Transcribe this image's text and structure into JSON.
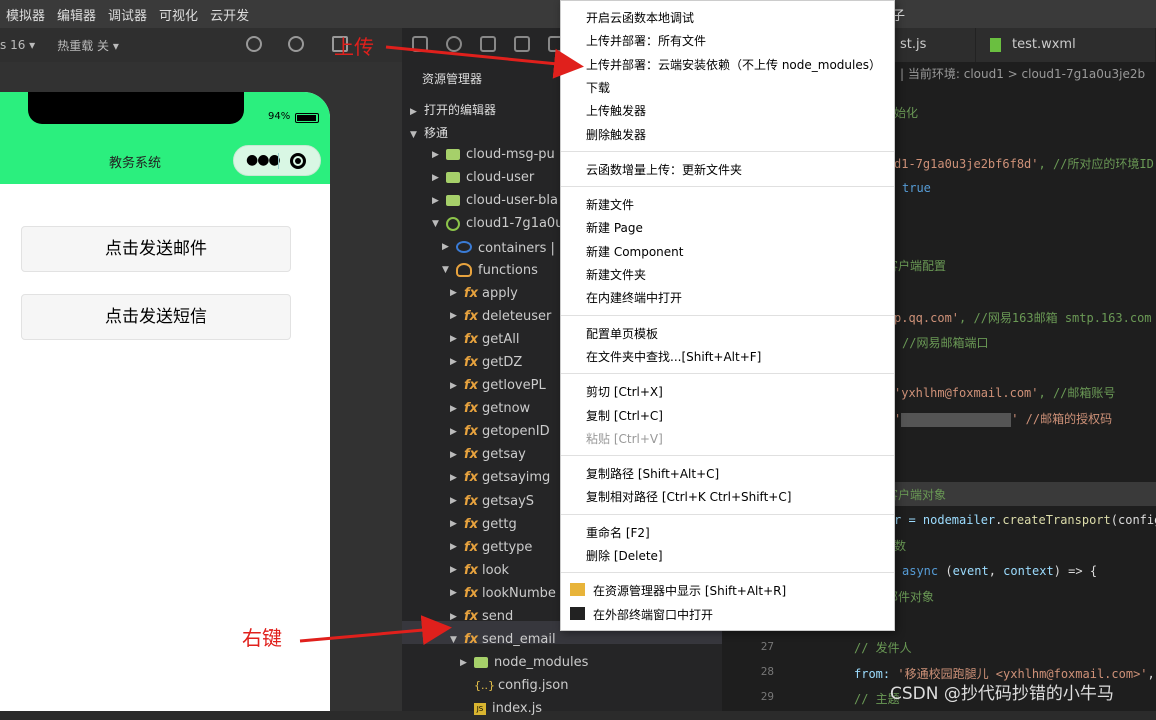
{
  "menubar": [
    "模拟器",
    "编辑器",
    "调试器",
    "可视化",
    "云开发"
  ],
  "toolbar2": {
    "zoom": "s 16 ▾",
    "hot": "热重载 关 ▾"
  },
  "phone": {
    "battery": "94%",
    "title": "教务系统",
    "buttons": [
      "点击发送邮件",
      "点击发送短信"
    ]
  },
  "explorer": {
    "title": "资源管理器",
    "sections": [
      "打开的编辑器",
      "移通"
    ],
    "items": [
      {
        "label": "cloud-msg-pu",
        "kind": "cloud"
      },
      {
        "label": "cloud-user",
        "kind": "cloud"
      },
      {
        "label": "cloud-user-bla",
        "kind": "cloud"
      },
      {
        "label": "cloud1-7g1a0u",
        "kind": "env"
      },
      {
        "label": "containers | 当",
        "kind": "cont"
      },
      {
        "label": "functions",
        "kind": "fnf"
      },
      {
        "label": "apply",
        "kind": "fx"
      },
      {
        "label": "deleteuser",
        "kind": "fx"
      },
      {
        "label": "getAll",
        "kind": "fx"
      },
      {
        "label": "getDZ",
        "kind": "fx"
      },
      {
        "label": "getlovePL",
        "kind": "fx"
      },
      {
        "label": "getnow",
        "kind": "fx"
      },
      {
        "label": "getopenID",
        "kind": "fx"
      },
      {
        "label": "getsay",
        "kind": "fx"
      },
      {
        "label": "getsayimg",
        "kind": "fx"
      },
      {
        "label": "getsayS",
        "kind": "fx"
      },
      {
        "label": "gettg",
        "kind": "fx"
      },
      {
        "label": "gettype",
        "kind": "fx"
      },
      {
        "label": "look",
        "kind": "fx"
      },
      {
        "label": "lookNumbe",
        "kind": "fx"
      },
      {
        "label": "send",
        "kind": "fx"
      },
      {
        "label": "send_email",
        "kind": "fx"
      },
      {
        "label": "node_modules",
        "kind": "folder"
      },
      {
        "label": "config.json",
        "kind": "json"
      },
      {
        "label": "index.js",
        "kind": "js"
      }
    ]
  },
  "editor": {
    "tabs": [
      "st.js",
      "test.wxml"
    ],
    "title_fragment": "子",
    "crumb": "| 当前环境: cloud1 > cloud1-7g1a0u3je2b",
    "line_numbers": [
      "27",
      "28",
      "29"
    ],
    "code": {
      "l1": "始化",
      "l2a": "d1-7g1a0u3je2bf6f8d'",
      "l2b": ", //所对应的环境ID",
      "l3": "true",
      "l4": "客户端配置",
      "l5a": "p.qq.com'",
      "l5b": ", //网易163邮箱 smtp.163.com",
      "l6": "//网易邮箱端口",
      "l7a": "'yxhlhm@foxmail.com'",
      "l7b": ", //邮箱账号",
      "l8a": "'",
      "l8b": "' //邮箱的授权码",
      "l9": "客户端对象",
      "l10a": "r = ",
      "l10b": "nodemailer",
      "l10c": ".",
      "l10d": "createTransport",
      "l10e": "(config",
      "l11": "数",
      "l12a": "async",
      "l12b": " (",
      "l12c": "event",
      "l12d": ", ",
      "l12e": "context",
      "l12f": ") => {",
      "l13": "邮件对象",
      "l14": "// 发件人",
      "l15a": "from: ",
      "l15b": "'移通校园跑腿儿 <yxhlhm@foxmail.com>'",
      "l15c": ",",
      "l16": "// 主题"
    }
  },
  "context_menu": {
    "groups": [
      [
        "开启云函数本地调试",
        "上传并部署：所有文件",
        "上传并部署：云端安装依赖（不上传 node_modules）",
        "下载",
        "上传触发器",
        "删除触发器"
      ],
      [
        "云函数增量上传：更新文件夹"
      ],
      [
        "新建文件",
        "新建 Page",
        "新建 Component",
        "新建文件夹",
        "在内建终端中打开"
      ],
      [
        "配置单页模板",
        "在文件夹中查找...[Shift+Alt+F]"
      ],
      [
        "剪切  [Ctrl+X]",
        "复制  [Ctrl+C]",
        "粘贴  [Ctrl+V]"
      ],
      [
        "复制路径  [Shift+Alt+C]",
        "复制相对路径  [Ctrl+K Ctrl+Shift+C]"
      ],
      [
        "重命名  [F2]",
        "删除  [Delete]"
      ],
      [
        "在资源管理器中显示  [Shift+Alt+R]",
        "在外部终端窗口中打开"
      ]
    ]
  },
  "annotations": {
    "upload": "上传",
    "right_click": "右键"
  },
  "watermark": "CSDN @抄代码抄错的小牛马",
  "colors": {
    "phone_nav": "#2bef7e",
    "annotation": "#e0201c",
    "fx_icon": "#e8a33e"
  }
}
